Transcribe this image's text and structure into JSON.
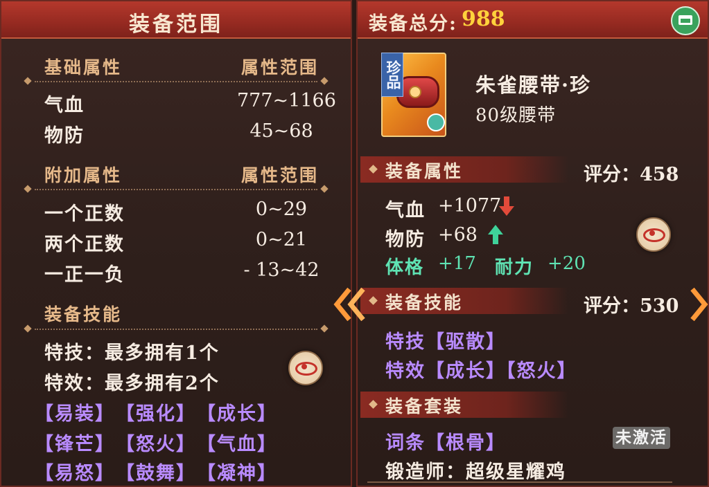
{
  "left": {
    "title": "装备范围",
    "base_header": {
      "label": "基础属性",
      "range": "属性范围"
    },
    "base_attrs": [
      {
        "name": "气血",
        "range": "777~1166"
      },
      {
        "name": "物防",
        "range": "45~68"
      }
    ],
    "extra_header": {
      "label": "附加属性",
      "range": "属性范围"
    },
    "extra_attrs": [
      {
        "name": "一个正数",
        "range": "0~29"
      },
      {
        "name": "两个正数",
        "range": "0~21"
      },
      {
        "name": "一正一负",
        "range": "- 13~42"
      }
    ],
    "skill_header": "装备技能",
    "skill_lines": [
      "特技：最多拥有1个",
      "特效：最多拥有2个"
    ],
    "skill_tags": [
      [
        "【易装】",
        "【强化】",
        "【成长】"
      ],
      [
        "【锋芒】",
        "【怒火】",
        "【气血】"
      ],
      [
        "【易怒】",
        "【鼓舞】",
        "【凝神】"
      ]
    ]
  },
  "right": {
    "score_label": "装备总分:",
    "score_value": "988",
    "item": {
      "badge": "珍品",
      "name": "朱雀腰带·珍",
      "subtitle": "80级腰带"
    },
    "attr_section": {
      "title": "装备属性",
      "score": "评分：458"
    },
    "attrs": [
      {
        "name": "气血",
        "value": "+1077",
        "trend": "down"
      },
      {
        "name": "物防",
        "value": "+68",
        "trend": "up"
      }
    ],
    "bonus": [
      {
        "name": "体格",
        "value": "+17"
      },
      {
        "name": "耐力",
        "value": "+20"
      }
    ],
    "skill_section": {
      "title": "装备技能",
      "score": "评分：530"
    },
    "skills": [
      "特技【驱散】",
      "特效【成长】【怒火】"
    ],
    "set_section": {
      "title": "装备套装"
    },
    "set_entry": "词条【根骨】",
    "set_status": "未激活",
    "forger": "锻造师：超级星耀鸡"
  },
  "colors": {
    "header_red": "#a8342a",
    "score_gold": "#ffd23c",
    "skill_purple": "#b98bff",
    "bonus_green": "#5fe3b3",
    "down_arrow": "#e24a3a",
    "up_arrow": "#3fd29a"
  },
  "icons": {
    "preview": "eye-icon",
    "compare_back": "chevron-left-icon",
    "compare_next": "chevron-right-icon",
    "corner": "green-chest-icon"
  }
}
